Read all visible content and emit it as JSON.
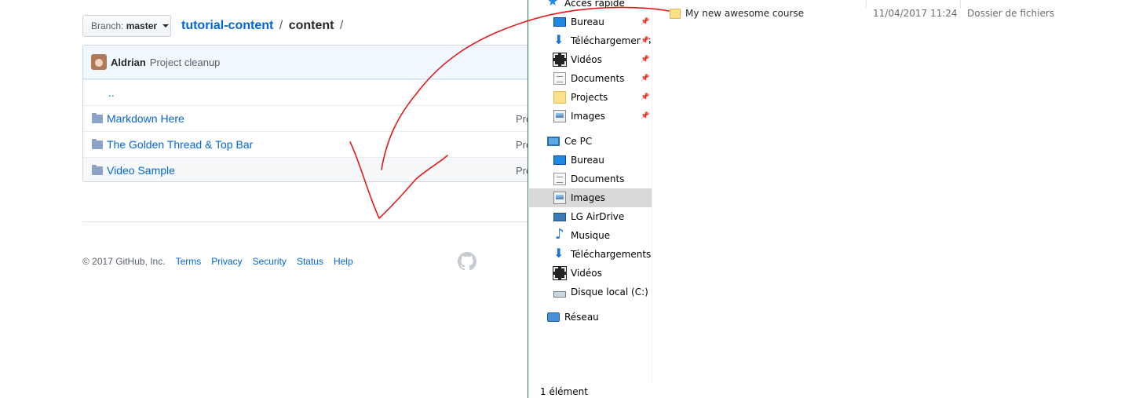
{
  "github": {
    "branch_prefix": "Branch:",
    "branch_name": "master",
    "repo": "tutorial-content",
    "sep1": "/",
    "folder": "content",
    "sep2": "/",
    "commit_author": "Aldrian",
    "commit_message": "Project cleanup",
    "parent_link": "..",
    "files": [
      {
        "name": "Markdown Here",
        "msg": "Pro"
      },
      {
        "name": "The Golden Thread & Top Bar",
        "msg": "Pro"
      },
      {
        "name": "Video Sample",
        "msg": "Pro"
      }
    ],
    "footer": {
      "copyright": "© 2017 GitHub, Inc.",
      "links": [
        "Terms",
        "Privacy",
        "Security",
        "Status",
        "Help"
      ]
    }
  },
  "explorer": {
    "quick_access": "Accès rapide",
    "quick_items": [
      {
        "label": "Bureau",
        "icon": "desktop-icon"
      },
      {
        "label": "Téléchargements",
        "icon": "download-icon"
      },
      {
        "label": "Vidéos",
        "icon": "video-icon"
      },
      {
        "label": "Documents",
        "icon": "document-icon"
      },
      {
        "label": "Projects",
        "icon": "folder-icon"
      },
      {
        "label": "Images",
        "icon": "images-icon"
      }
    ],
    "this_pc": "Ce PC",
    "pc_items": [
      {
        "label": "Bureau",
        "icon": "desktop-icon"
      },
      {
        "label": "Documents",
        "icon": "document-icon"
      },
      {
        "label": "Images",
        "icon": "images-icon"
      },
      {
        "label": "LG AirDrive",
        "icon": "laptop-icon"
      },
      {
        "label": "Musique",
        "icon": "music-icon"
      },
      {
        "label": "Téléchargements",
        "icon": "download-icon"
      },
      {
        "label": "Vidéos",
        "icon": "video-icon"
      },
      {
        "label": "Disque local (C:)",
        "icon": "disk-icon"
      }
    ],
    "network": "Réseau",
    "file": {
      "name": "My new awesome course",
      "date": "11/04/2017 11:24",
      "type": "Dossier de fichiers"
    },
    "status": "1 élément"
  },
  "colors": {
    "link": "#0366d6",
    "annotation": "#e01b1b",
    "selection": "#d9d9d9"
  }
}
